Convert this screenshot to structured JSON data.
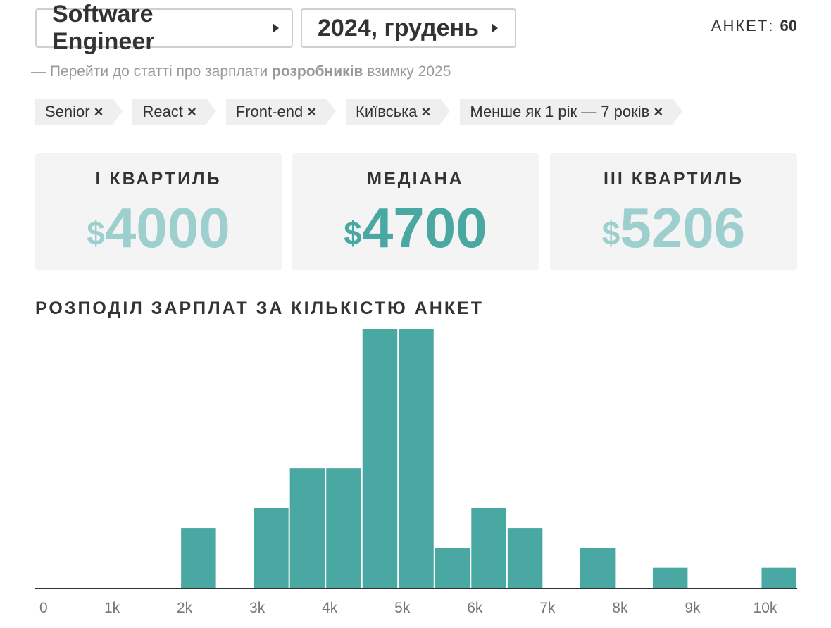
{
  "header": {
    "role": "Software Engineer",
    "period": "2024, грудень",
    "count_label": "АНКЕТ:",
    "count_value": "60"
  },
  "article_link": {
    "prefix": "— Перейти до статті про зарплати ",
    "bold": "розробників",
    "suffix": " взимку 2025"
  },
  "filters": [
    "Senior",
    "React",
    "Front-end",
    "Київська",
    "Менше як 1 рік — 7 років"
  ],
  "filter_remove_glyph": "×",
  "stats": {
    "q1": {
      "label": "I КВАРТИЛЬ",
      "currency": "$",
      "value": "4000"
    },
    "median": {
      "label": "МЕДІАНА",
      "currency": "$",
      "value": "4700"
    },
    "q3": {
      "label": "III КВАРТИЛЬ",
      "currency": "$",
      "value": "5206"
    }
  },
  "colors": {
    "bar": "#4aa8a3",
    "quartile": "#9ccfcd",
    "median": "#4aa8a3"
  },
  "chart_data": {
    "type": "bar",
    "title": "РОЗПОДІЛ ЗАРПЛАТ ЗА КІЛЬКІСТЮ АНКЕТ",
    "bin_width": 500,
    "x": [
      0,
      500,
      1000,
      1500,
      2000,
      2500,
      3000,
      3500,
      4000,
      4500,
      5000,
      5500,
      6000,
      6500,
      7000,
      7500,
      8000,
      8500,
      9000,
      9500,
      10000
    ],
    "values": [
      0,
      0,
      0,
      0,
      3,
      0,
      4,
      6,
      6,
      13,
      13,
      2,
      4,
      3,
      0,
      2,
      0,
      1,
      0,
      0,
      1
    ],
    "xlim": [
      0,
      10500
    ],
    "ylim": [
      0,
      13
    ],
    "tick_values": [
      0,
      1000,
      2000,
      3000,
      4000,
      5000,
      6000,
      7000,
      8000,
      9000,
      10000
    ],
    "tick_labels": [
      "0",
      "1k",
      "2k",
      "3k",
      "4k",
      "5k",
      "6k",
      "7k",
      "8k",
      "9k",
      "10k"
    ],
    "grid": false
  }
}
